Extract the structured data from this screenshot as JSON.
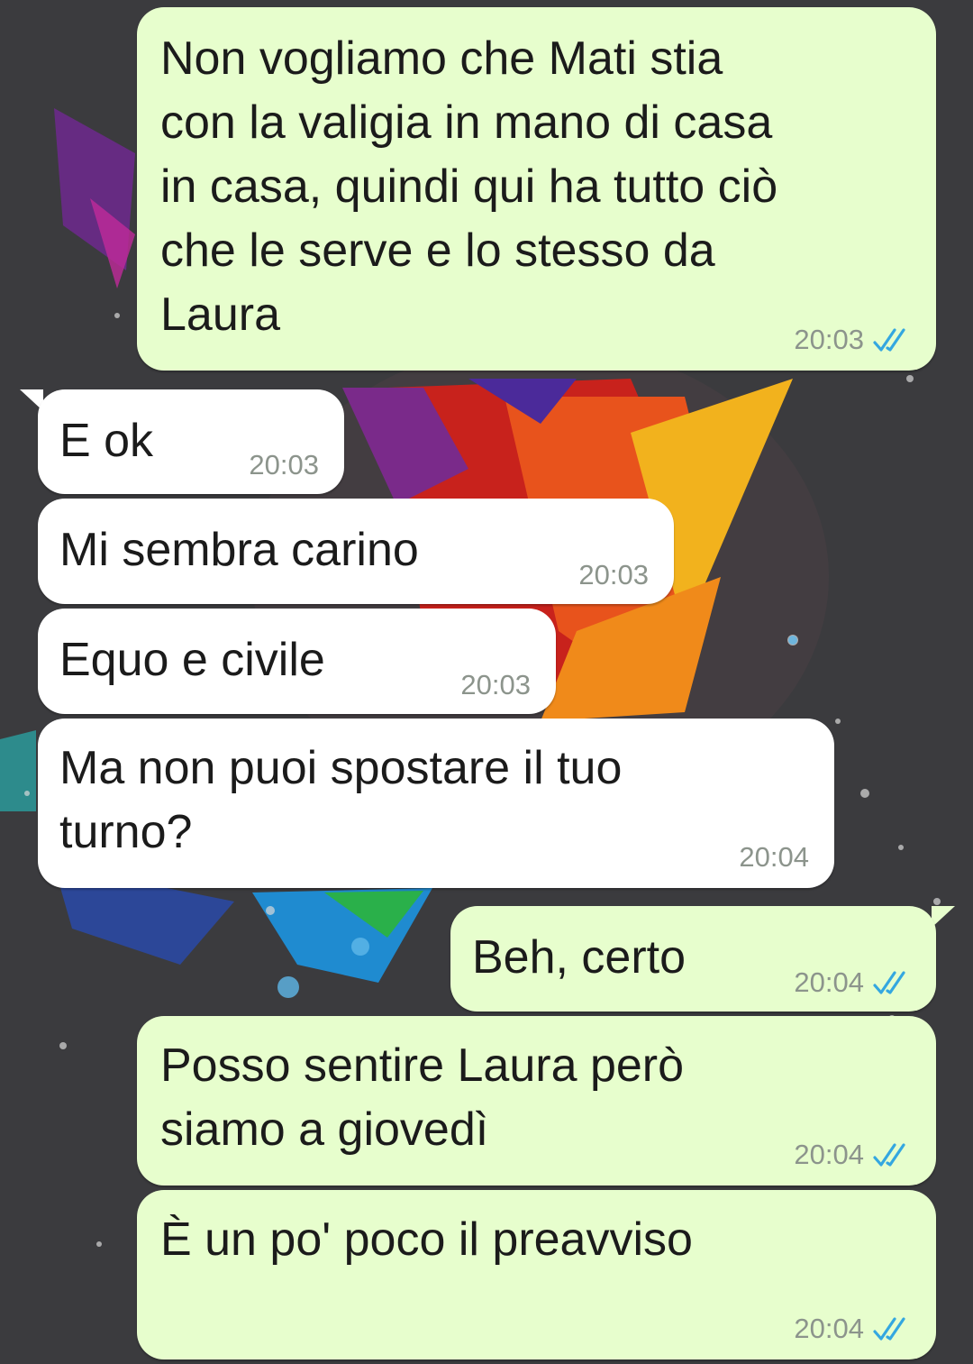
{
  "messages": [
    {
      "direction": "outgoing",
      "text": "Non vogliamo che Mati stia\ncon la valigia in mano di casa\nin casa, quindi qui ha tutto ciò\nche le serve e lo stesso da\nLaura",
      "time": "20:03",
      "status": "read"
    },
    {
      "direction": "incoming",
      "text": "E ok",
      "time": "20:03"
    },
    {
      "direction": "incoming",
      "text": "Mi sembra carino",
      "time": "20:03"
    },
    {
      "direction": "incoming",
      "text": "Equo e civile",
      "time": "20:03"
    },
    {
      "direction": "incoming",
      "text": "Ma non puoi spostare il tuo\nturno?",
      "time": "20:04"
    },
    {
      "direction": "outgoing",
      "text": "Beh, certo",
      "time": "20:04",
      "status": "read"
    },
    {
      "direction": "outgoing",
      "text": "Posso sentire Laura però\nsiamo a giovedì",
      "time": "20:04",
      "status": "read"
    },
    {
      "direction": "outgoing",
      "text": "È un po' poco il preavviso",
      "time": "20:04",
      "status": "read"
    }
  ],
  "colors": {
    "outgoing_bubble": "#e7fecd",
    "incoming_bubble": "#ffffff",
    "timestamp": "#8c948c",
    "read_ticks": "#34a7e0"
  },
  "icons": {
    "read_receipt": "double-check-icon"
  }
}
